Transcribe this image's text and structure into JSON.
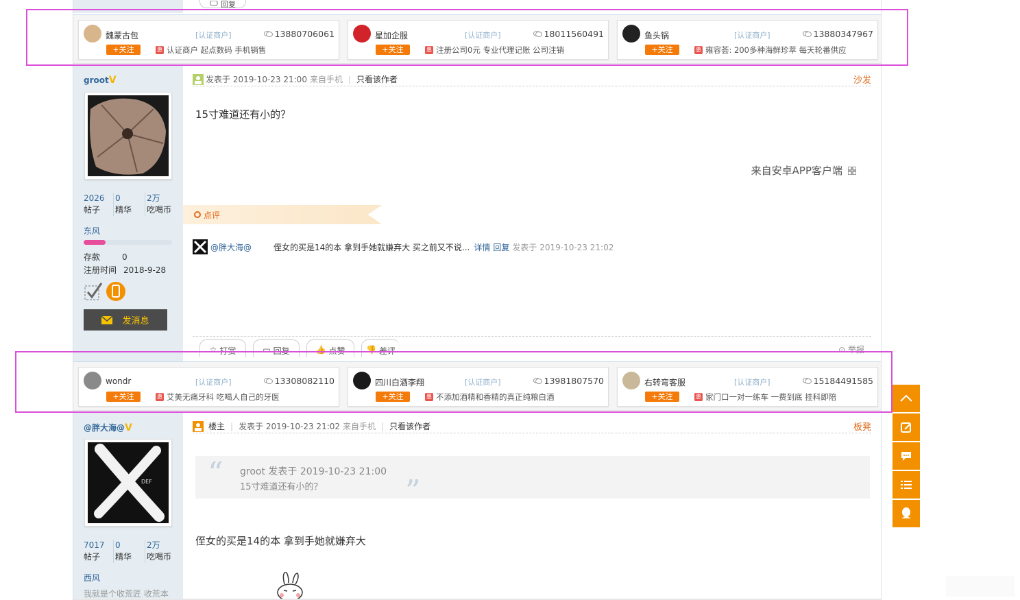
{
  "top_reply_label": "回复",
  "ad_rows": [
    {
      "cards": [
        {
          "name": "魏蒙古包",
          "tag": "[认证商户]",
          "phone": "13880706061",
          "follow": "+关注",
          "hui": "惠",
          "desc": "认证商户 起点数码 手机销售",
          "avatar_color": "#d8b58a"
        },
        {
          "name": "星加企服",
          "tag": "[认证商户]",
          "phone": "18011560491",
          "follow": "+关注",
          "hui": "惠",
          "desc": "注册公司0元 专业代理记账 公司注销",
          "avatar_color": "#d2232a"
        },
        {
          "name": "鱼头锅",
          "tag": "[认证商户]",
          "phone": "13880347967",
          "follow": "+关注",
          "hui": "惠",
          "desc": "雍容荟: 200多种海鲜珍萃 每天轮番供应",
          "avatar_color": "#222222"
        }
      ]
    },
    {
      "cards": [
        {
          "name": "wondr",
          "tag": "[认证商户]",
          "phone": "13308082110",
          "follow": "+关注",
          "hui": "惠",
          "desc": "艾美无痛牙科 吃喝人自己的牙医",
          "avatar_color": "#8a8a8a"
        },
        {
          "name": "四川白酒李翔",
          "tag": "[认证商户]",
          "phone": "13981807570",
          "follow": "+关注",
          "hui": "惠",
          "desc": "不添加酒精和香精的真正纯粮白酒",
          "avatar_color": "#1a1a1a"
        },
        {
          "name": "右转弯客服",
          "tag": "[认证商户]",
          "phone": "15184491585",
          "follow": "+关注",
          "hui": "惠",
          "desc": "家门口一对一练车 一费到底 挂科即陪",
          "avatar_color": "#c9b99a"
        }
      ]
    }
  ],
  "post1": {
    "user": {
      "name": "groot",
      "v": "V",
      "stats": [
        {
          "num": "2026",
          "label": "帖子"
        },
        {
          "num": "0",
          "label": "精华"
        },
        {
          "num": "2万",
          "label": "吃喝币"
        }
      ],
      "group": "东风",
      "level_fraction": 0.25,
      "deposit_label": "存款",
      "deposit_value": "0",
      "reg_label": "注册时间",
      "reg_value": "2018-9-28",
      "msg_button": "发消息"
    },
    "posted": "发表于 2019-10-23 21:00",
    "source": "来自手机",
    "author_only": "只看该作者",
    "floor": "沙发",
    "text": "15寸难道还有小的？",
    "app_line": "来自安卓APP客户端",
    "dianping": "点评",
    "comment": {
      "who": "@胖大海@",
      "text": "侄女的买是14的本 拿到手她就嫌弃大 买之前又不说...",
      "detail": "详情",
      "reply": "回复",
      "time": "发表于 2019-10-23 21:02"
    },
    "actions": [
      "打赏",
      "回复",
      "点赞",
      "差评"
    ],
    "report": "举报"
  },
  "post2": {
    "user": {
      "name": "@胖大海@",
      "v": "V",
      "stats": [
        {
          "num": "7017",
          "label": "帖子"
        },
        {
          "num": "0",
          "label": "精华"
        },
        {
          "num": "2万",
          "label": "吃喝币"
        }
      ],
      "group": "西风",
      "signature": "我就是个收荒匠 收荒本"
    },
    "op_label": "楼主",
    "posted": "发表于 2019-10-23 21:02",
    "source": "来自手机",
    "author_only": "只看该作者",
    "floor": "板凳",
    "quote_line1": "groot 发表于 2019-10-23 21:00",
    "quote_line2": "15寸难道还有小的？",
    "text": "侄女的买是14的本 拿到手她就嫌弃大"
  },
  "float_toolbar": [
    "top-arrow-icon",
    "edit-icon",
    "comment-icon",
    "list-icon",
    "qq-icon"
  ],
  "colors": {
    "accent": "#f39000",
    "link": "#336699",
    "highlight": "#d94fd9"
  }
}
